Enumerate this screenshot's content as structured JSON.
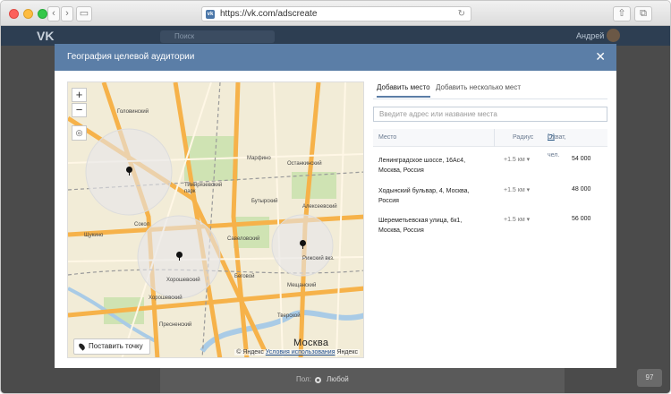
{
  "browser": {
    "url": "https://vk.com/adscreate",
    "nav_back": "‹",
    "nav_forward": "›",
    "sidebar_icon": "▭",
    "reload_icon": "↻",
    "share_icon": "⇧",
    "tabs_icon": "⧉",
    "favicon_text": "vk"
  },
  "vk_header": {
    "logo": "VK",
    "search_placeholder": "Поиск",
    "user_name": "Андрей"
  },
  "modal": {
    "title": "География целевой аудитории",
    "close_icon": "✕"
  },
  "map": {
    "zoom_in": "+",
    "zoom_out": "−",
    "locate_icon": "◎",
    "set_point_label": "Поставить точку",
    "copyright": "© Яндекс",
    "terms_link": "Условия использования",
    "brand": "Яндекс",
    "city_label": "Москва",
    "place_labels": [
      "Головинский",
      "Марфино",
      "Останкинский",
      "Тимирязевский парк",
      "Бутырский",
      "Сокол",
      "Алексеевский",
      "Щукино",
      "Савеловский",
      "Хорошевский",
      "Беговой",
      "Мещанский",
      "Хорошевский",
      "Тверской",
      "Пресненский",
      "Рижский вкз."
    ]
  },
  "tabs": {
    "add_place": "Добавить место",
    "add_multiple": "Добавить несколько мест"
  },
  "search": {
    "placeholder": "Введите адрес или название места"
  },
  "table": {
    "col_place": "Место",
    "col_radius": "Радиус",
    "col_coverage": "Охват, чел.",
    "col_help": "[?]",
    "rows": [
      {
        "address": "Ленинградское шоссе, 16Ас4, Москва, Россия",
        "radius": "+1.5 км",
        "coverage": "54 000"
      },
      {
        "address": "Ходынский бульвар, 4, Москва, Россия",
        "radius": "+1.5 км",
        "coverage": "48 000"
      },
      {
        "address": "Шереметьевская улица, 6к1, Москва, Россия",
        "radius": "+1.5 км",
        "coverage": "56 000"
      }
    ]
  },
  "page_bottom": {
    "label": "Пол:",
    "option": "Любой",
    "counter": "97"
  },
  "colors": {
    "modal_header": "#5b7ea7",
    "vk_bar": "#2d3e52",
    "map_road": "#f6b24a"
  }
}
